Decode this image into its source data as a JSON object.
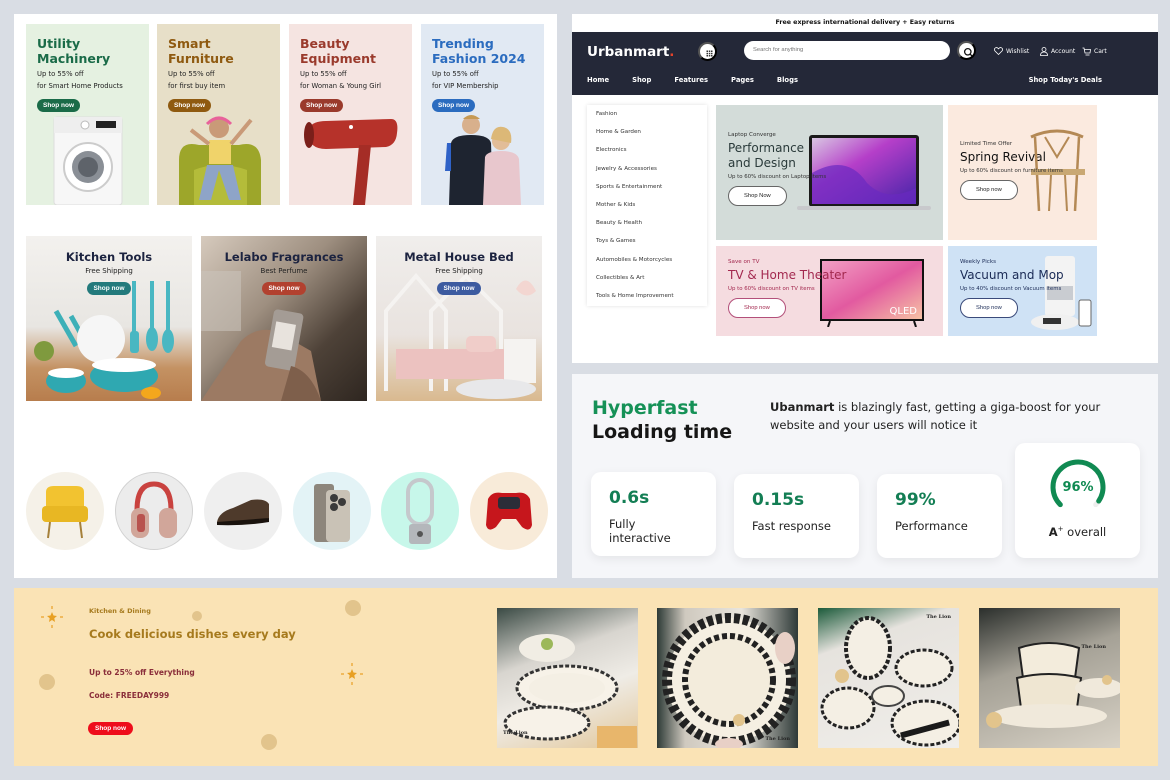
{
  "promos": [
    {
      "title_line1": "Utility",
      "title_line2": "Machinery",
      "line1": "Up to 55% off",
      "line2": "for Smart Home Products",
      "button": "Shop now",
      "image": "washing-machine",
      "color": "#1a6b48",
      "bg": "#e5f1e1"
    },
    {
      "title_line1": "Smart",
      "title_line2": "Furniture",
      "line1": "Up to 55% off",
      "line2": "for first buy item",
      "button": "Shop now",
      "image": "woman-in-armchair",
      "color": "#8f5a10",
      "bg": "#e7dfc8"
    },
    {
      "title_line1": "Beauty",
      "title_line2": "Equipment",
      "line1": "Up to 55% off",
      "line2": "for Woman & Young Girl",
      "button": "Shop now",
      "image": "hair-dryer",
      "color": "#9a3a2c",
      "bg": "#f5e4e1"
    },
    {
      "title_line1": "Trending",
      "title_line2": "Fashion 2024",
      "line1": "Up to 55% off",
      "line2": "for VIP Membership",
      "button": "Shop now",
      "image": "fashion-models",
      "color": "#2b6cbf",
      "bg": "#e1e9f3"
    }
  ],
  "categories": [
    {
      "title": "Kitchen Tools",
      "subtitle": "Free Shipping",
      "button": "Shop now",
      "btn_color": "#237a7c"
    },
    {
      "title": "Lelabo Fragrances",
      "subtitle": "Best Perfume",
      "button": "Shop now",
      "btn_color": "#b2412f"
    },
    {
      "title": "Metal House Bed",
      "subtitle": "Free Shipping",
      "button": "Shop now",
      "btn_color": "#3d5ba0"
    }
  ],
  "circle_products": [
    "armchair",
    "headphones",
    "shoe",
    "smartphone",
    "air-purifier-fan",
    "game-controller"
  ],
  "store": {
    "announcement": "Free express international delivery + Easy returns",
    "logo": "Urbanmart",
    "logo_dot": ".",
    "search_placeholder": "Search for anything",
    "wishlist": "Wishlist",
    "account": "Account",
    "cart": "Cart",
    "nav": [
      "Home",
      "Shop",
      "Features",
      "Pages",
      "Blogs"
    ],
    "deals": "Shop Today's Deals",
    "menu": [
      "Fashion",
      "Home & Garden",
      "Electronics",
      "Jewelry & Accessories",
      "Sports & Entertainment",
      "Mother & Kids",
      "Beauty & Health",
      "Toys & Games",
      "Automobiles & Motorcycles",
      "Collectibles & Art",
      "Tools & Home Improvement"
    ],
    "banners": [
      {
        "kicker": "Laptop Converge",
        "title_line1": "Performance",
        "title_line2": "and Design",
        "desc": "Up to 60% discount on Laptop items",
        "button": "Shop Now",
        "color": "#2a3a3a"
      },
      {
        "kicker": "Limited Time Offer",
        "title_line1": "Spring Revival",
        "title_line2": "",
        "desc": "Up to 60% discount on furniture items",
        "button": "Shop now",
        "color": "#111111"
      },
      {
        "kicker": "Save on TV",
        "title_line1": "TV & Home Theater",
        "title_line2": "",
        "desc": "Up to 60% discount on TV items",
        "button": "Shop now",
        "color": "#a3294f",
        "tv_brand": "QLED"
      },
      {
        "kicker": "Weekly Picks",
        "title_line1": "Vacuum and Mop",
        "title_line2": "",
        "desc": "Up to 40% discount on Vacuum items",
        "button": "Shop now",
        "color": "#1a2a55"
      }
    ]
  },
  "performance": {
    "title_green": "Hyperfast",
    "title_dark": "Loading time",
    "brand": "Ubanmart",
    "desc": " is blazingly fast, getting a giga-boost for your website and your users will notice it",
    "stats": [
      {
        "value": "0.6s",
        "label": "Fully interactive"
      },
      {
        "value": "0.15s",
        "label": "Fast response"
      },
      {
        "value": "99%",
        "label": "Performance"
      }
    ],
    "gauge": {
      "value": "96%",
      "fraction": 0.96,
      "label_grade": "A",
      "label_sup": "+",
      "label_rest": " overall"
    }
  },
  "kitchen": {
    "kicker": "Kitchen & Dining",
    "title": "Cook delicious dishes every day",
    "offer": "Up to 25% off Everything",
    "code": "Code: FREEDAY999",
    "button": "Shop now",
    "photos": [
      "tableware-dinner-setting",
      "ceramic-plate-held",
      "tableware-set-flatlay",
      "stacked-bowls"
    ],
    "brand_tag": "The Lion"
  }
}
